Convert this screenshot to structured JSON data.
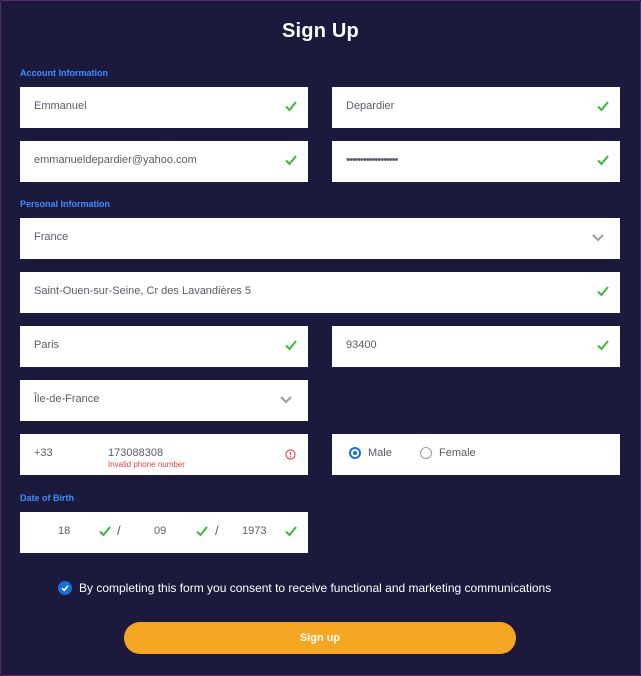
{
  "title": "Sign Up",
  "sections": {
    "account": "Account Information",
    "personal": "Personal Information",
    "dob": "Date of Birth"
  },
  "fields": {
    "first_name": "Emmanuel",
    "last_name": "Depardier",
    "email": "emmanueldepardier@yahoo.com",
    "password": "••••••••••••••••••",
    "country": "France",
    "address": "Saint-Ouen-sur-Seine, Cr des Lavandières 5",
    "city": "Paris",
    "postal_code": "93400",
    "region": "Île-de-France",
    "phone_code": "+33",
    "phone_number": "173088308",
    "phone_error": "Invalid phone number"
  },
  "gender": {
    "options": [
      "Male",
      "Female"
    ],
    "selected": "Male"
  },
  "dob": {
    "day": "18",
    "month": "09",
    "year": "1973",
    "separator": "/"
  },
  "consent": {
    "checked": true,
    "text": "By completing this form you consent to receive functional and marketing communications"
  },
  "submit_label": "Sign up",
  "colors": {
    "background": "#1c1a3c",
    "section_label": "#3f8cff",
    "valid": "#3db83a",
    "error": "#e0443c",
    "accent_blue": "#1a6fd6",
    "button": "#f5a623"
  },
  "icons": {
    "valid": "check-icon",
    "select": "chevron-down-icon",
    "error": "alert-circle-icon"
  }
}
